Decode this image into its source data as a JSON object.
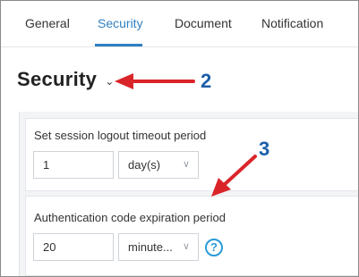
{
  "tabs": [
    {
      "label": "General"
    },
    {
      "label": "Security"
    },
    {
      "label": "Document"
    },
    {
      "label": "Notification"
    }
  ],
  "active_tab": "Security",
  "heading": {
    "title": "Security",
    "chevron": "⌄"
  },
  "annotations": [
    {
      "number": "2"
    },
    {
      "number": "3"
    }
  ],
  "session": {
    "label": "Set session logout timeout period",
    "value": "1",
    "unit": "day(s)"
  },
  "auth_code": {
    "label": "Authentication code expiration period",
    "value": "20",
    "unit": "minute...",
    "help": "?"
  },
  "colors": {
    "accent": "#2f7fc1",
    "annotation_arrow": "#d9252a",
    "annotation_number": "#1d5fa8",
    "help_icon": "#2a9bd8"
  }
}
